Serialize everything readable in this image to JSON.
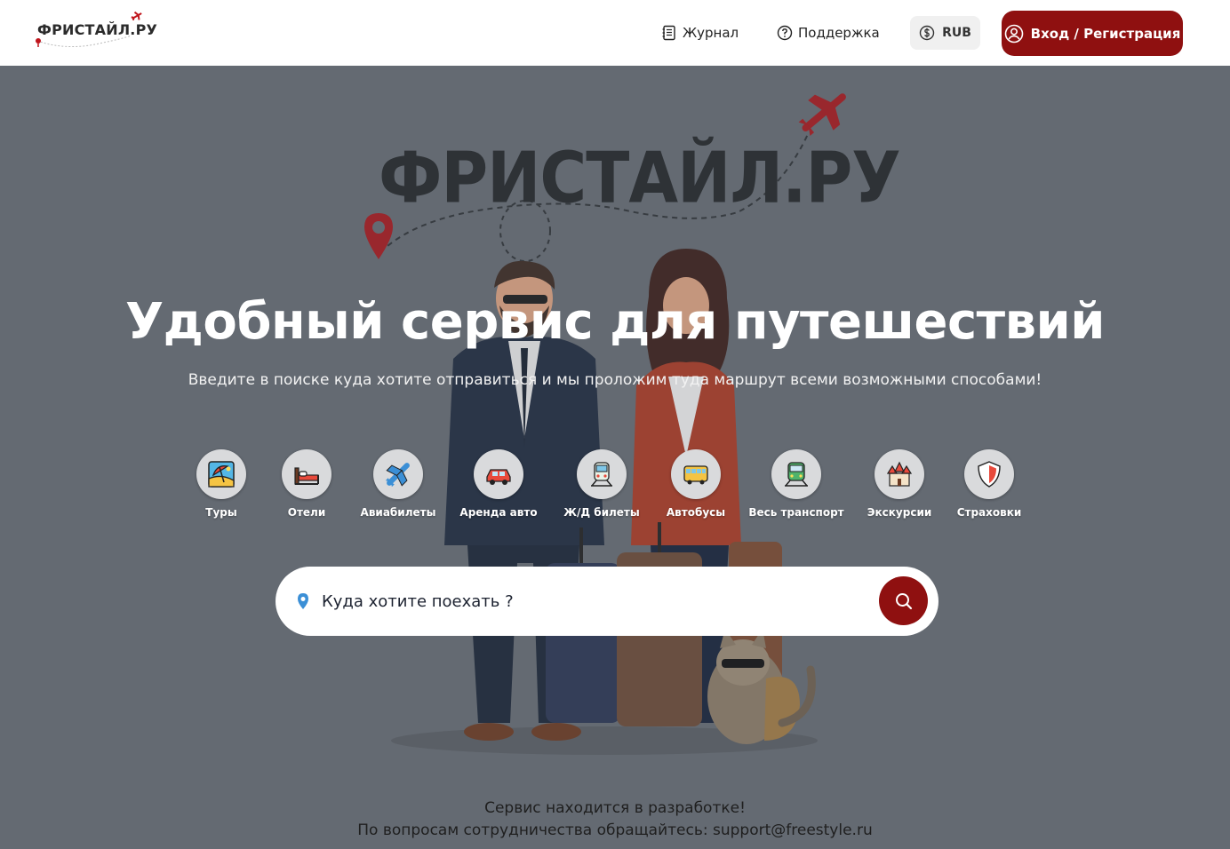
{
  "header": {
    "logo_text": "ФРИСТАЙЛ.РУ",
    "nav": {
      "journal": "Журнал",
      "support": "Поддержка"
    },
    "currency": "RUB",
    "login": "Вход / Регистрация"
  },
  "hero": {
    "brand": "ФРИСТАЙЛ.РУ",
    "title": "Удобный сервис для путешествий",
    "subtitle": "Введите в поиске куда хотите отправиться и мы проложим туда маршрут всеми возможными способами!",
    "categories": [
      {
        "label": "Туры",
        "icon": "beach-icon"
      },
      {
        "label": "Отели",
        "icon": "bed-icon"
      },
      {
        "label": "Авиабилеты",
        "icon": "airplane-icon"
      },
      {
        "label": "Аренда авто",
        "icon": "car-icon"
      },
      {
        "label": "Ж/Д билеты",
        "icon": "train-icon"
      },
      {
        "label": "Автобусы",
        "icon": "bus-icon"
      },
      {
        "label": "Весь транспорт",
        "icon": "transport-icon"
      },
      {
        "label": "Экскурсии",
        "icon": "castle-icon"
      },
      {
        "label": "Страховки",
        "icon": "shield-icon"
      }
    ],
    "search": {
      "placeholder": "Куда хотите поехать ?"
    }
  },
  "footer": {
    "line1": "Сервис находится в разработке!",
    "line2": "По вопросам сотрудничества обращайтесь: support@freestyle.ru"
  },
  "colors": {
    "accent": "#8f1010",
    "hero_bg": "#656b72",
    "header_bg": "#ffffff"
  }
}
